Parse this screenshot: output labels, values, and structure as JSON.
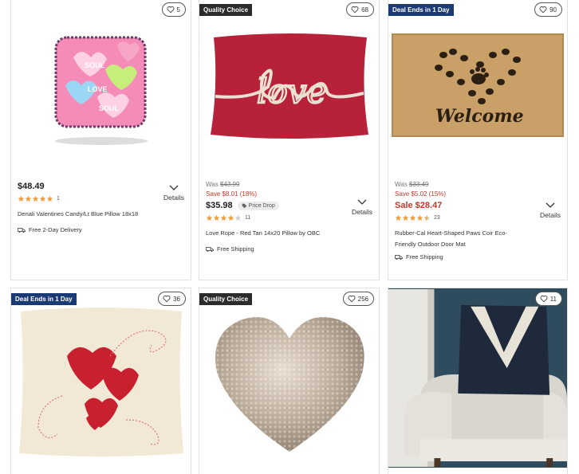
{
  "products": [
    {
      "fav_count": "5",
      "price": "$48.49",
      "rating_count": "1",
      "rating": 5,
      "details_label": "Details",
      "name": "Denali Valentines Candy/Lt Blue Pillow 18x18",
      "shipping": "Free 2-Day Delivery",
      "image": "candy-hearts-pillow"
    },
    {
      "badge": "Quality Choice",
      "fav_count": "68",
      "was_label": "Was",
      "was_price": "$43.99",
      "save_text": "Save $8.01 (18%)",
      "price": "$35.98",
      "price_drop_label": "Price Drop",
      "rating_count": "11",
      "rating": 4,
      "details_label": "Details",
      "name": "Love Rope - Red Tan 14x20 Pillow by OBC",
      "shipping": "Free Shipping",
      "image": "red-love-pillow"
    },
    {
      "badge": "Deal Ends in 1 Day",
      "fav_count": "90",
      "was_label": "Was",
      "was_price": "$33.49",
      "save_text": "Save $5.02 (15%)",
      "price": "Sale $28.47",
      "rating_count": "23",
      "rating": 4.5,
      "details_label": "Details",
      "name_line1": "Rubber-Cal Heart-Shaped Paws Coir Eco-",
      "name_line2": "Friendly Outdoor Door Mat",
      "shipping": "Free Shipping",
      "image": "welcome-doormat",
      "image_text": "Welcome"
    },
    {
      "badge": "Deal Ends in 1 Day",
      "fav_count": "36",
      "image": "red-hearts-pillow"
    },
    {
      "badge": "Quality Choice",
      "fav_count": "256",
      "image": "sequin-heart-pillow"
    },
    {
      "fav_count": "11",
      "image": "navy-pillow-on-chair"
    }
  ],
  "colors": {
    "deal_badge": "#1b3a73",
    "quality_badge": "#2b2b2b",
    "sale_red": "#c0392b",
    "star_orange": "#f29d38"
  }
}
